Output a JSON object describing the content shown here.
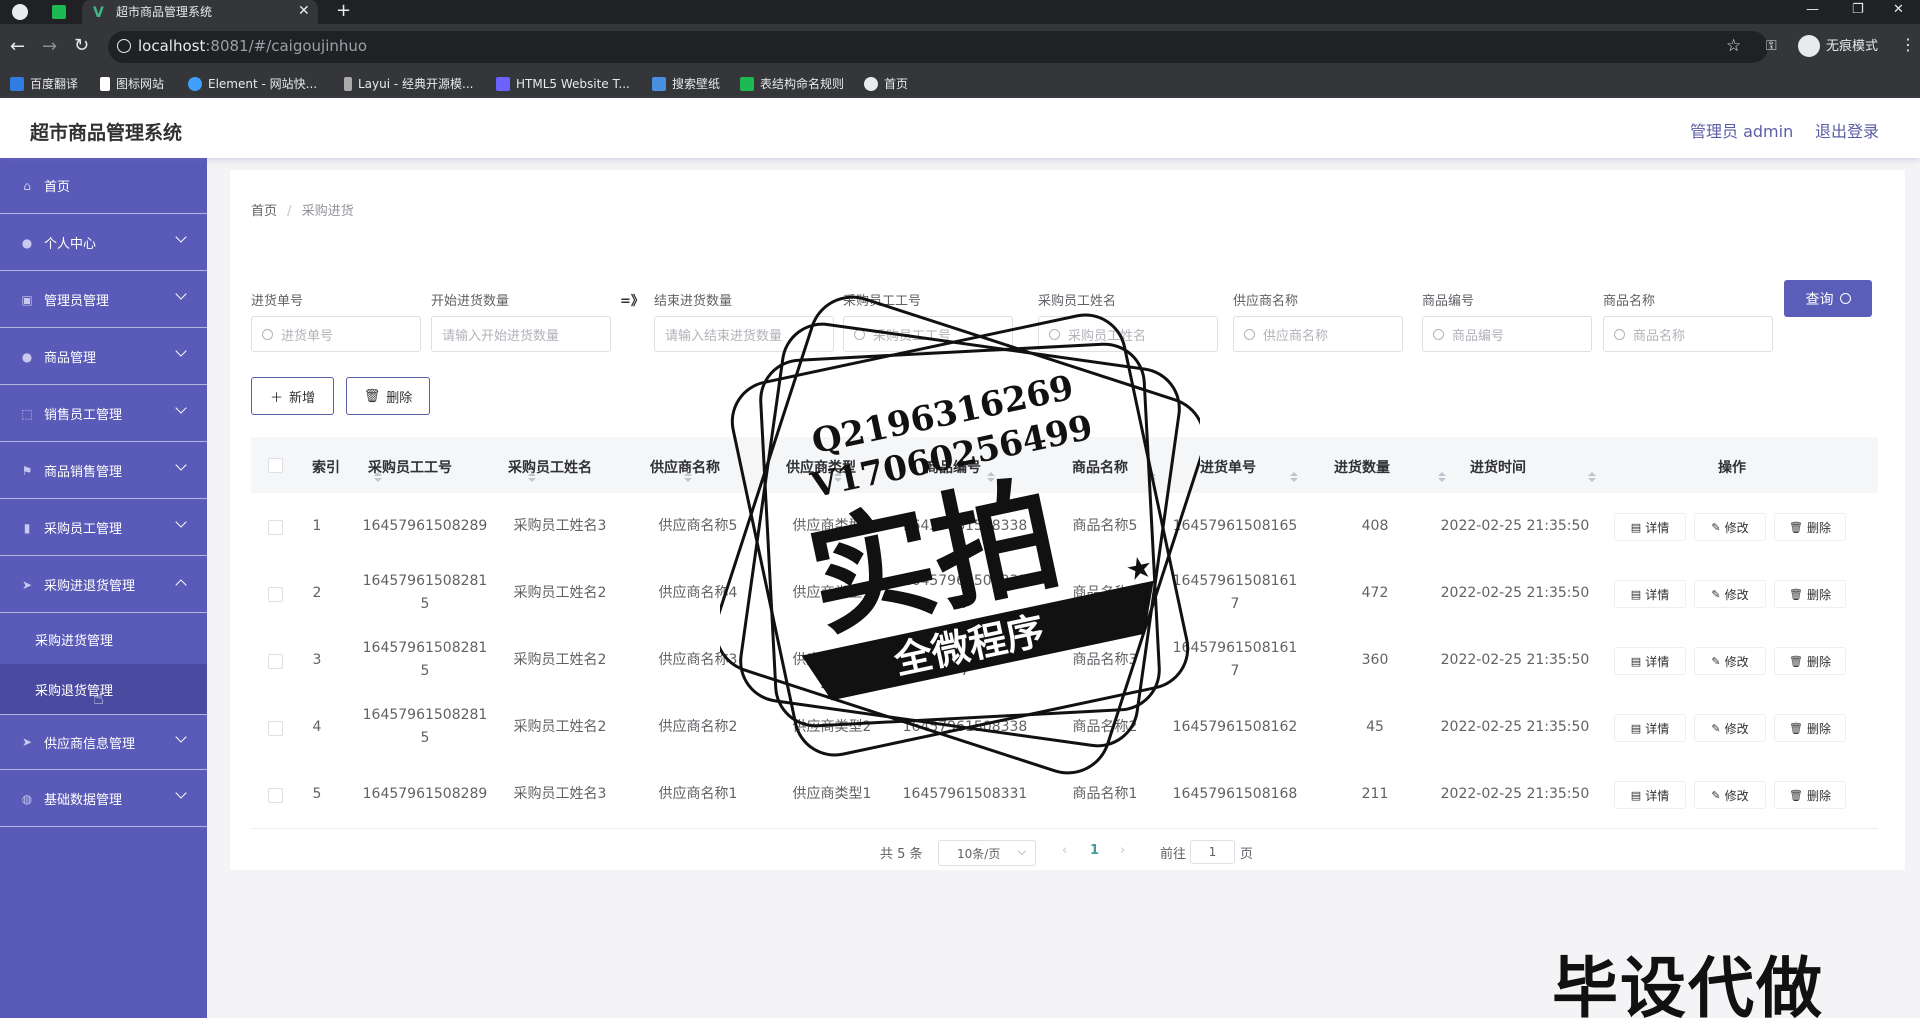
{
  "browser": {
    "tab_title": "超市商品管理系统",
    "url_host": "localhost",
    "url_rest": ":8081/#/caigoujinhuo",
    "profile_label": "无痕模式",
    "bookmarks": [
      "百度翻译",
      "图标网站",
      "Element - 网站快...",
      "Layui - 经典开源模...",
      "HTML5 Website T...",
      "搜索壁纸",
      "表结构命名规则",
      "首页"
    ]
  },
  "header": {
    "title": "超市商品管理系统",
    "user_label": "管理员 admin",
    "logout_label": "退出登录"
  },
  "sidebar": {
    "items": [
      {
        "label": "首页",
        "icon": "home-icon"
      },
      {
        "label": "个人中心",
        "icon": "user-icon"
      },
      {
        "label": "管理员管理",
        "icon": "briefcase-icon"
      },
      {
        "label": "商品管理",
        "icon": "user-icon"
      },
      {
        "label": "销售员工管理",
        "icon": "crop-icon"
      },
      {
        "label": "商品销售管理",
        "icon": "flag-icon"
      },
      {
        "label": "采购员工管理",
        "icon": "chart-icon"
      },
      {
        "label": "采购进退货管理",
        "icon": "send-icon"
      }
    ],
    "sub_items": [
      "采购进货管理",
      "采购退货管理"
    ],
    "items_after": [
      {
        "label": "供应商信息管理",
        "icon": "send-icon"
      },
      {
        "label": "基础数据管理",
        "icon": "globe-icon"
      }
    ]
  },
  "breadcrumb": {
    "home": "首页",
    "sep": "/",
    "current": "采购进货"
  },
  "filters": {
    "labels": [
      "进货单号",
      "开始进货数量",
      "结束进货数量",
      "采购员工工号",
      "采购员工姓名",
      "供应商名称",
      "商品编号",
      "商品名称"
    ],
    "range_sep": "=》",
    "placeholders": [
      "进货单号",
      "请输入开始进货数量",
      "请输入结束进货数量",
      "采购员工工号",
      "采购员工姓名",
      "供应商名称",
      "商品编号",
      "商品名称"
    ],
    "query_label": "查询"
  },
  "actions": {
    "add": "新增",
    "delete": "删除"
  },
  "table": {
    "columns": [
      "索引",
      "采购员工工号",
      "采购员工姓名",
      "供应商名称",
      "供应商类型",
      "商品编号",
      "商品名称",
      "进货单号",
      "进货数量",
      "进货时间",
      "操作"
    ],
    "rows": [
      [
        "1",
        "16457961508289",
        "采购员工姓名3",
        "供应商名称5",
        "供应商类型3",
        "16457961508338",
        "商品名称5",
        "16457961508165",
        "408",
        "2022-02-25 21:35:50"
      ],
      [
        "2",
        "164579615082815",
        "采购员工姓名2",
        "供应商名称4",
        "供应商类型1",
        "164579615083317",
        "商品名称4",
        "164579615081617",
        "472",
        "2022-02-25 21:35:50"
      ],
      [
        "3",
        "164579615082815",
        "采购员工姓名2",
        "供应商名称3",
        "供应商类型1",
        "164579615083317",
        "商品名称3",
        "164579615081617",
        "360",
        "2022-02-25 21:35:50"
      ],
      [
        "4",
        "164579615082815",
        "采购员工姓名2",
        "供应商名称2",
        "供应商类型2",
        "16457961508338",
        "商品名称2",
        "16457961508162",
        "45",
        "2022-02-25 21:35:50"
      ],
      [
        "5",
        "16457961508289",
        "采购员工姓名3",
        "供应商名称1",
        "供应商类型1",
        "16457961508331",
        "商品名称1",
        "16457961508168",
        "211",
        "2022-02-25 21:35:50"
      ]
    ],
    "row_actions": [
      "详情",
      "修改",
      "删除"
    ]
  },
  "pagination": {
    "total": "共 5 条",
    "page_size": "10条/页",
    "current_page": "1",
    "goto_prefix": "前往",
    "goto_value": "1",
    "goto_suffix": "页"
  },
  "stamp": {
    "line1": "Q2196316269",
    "line2": "V17060256499",
    "big": "实拍",
    "ribbon": "全微程序"
  },
  "watermark": "毕设代做",
  "colors": {
    "sidebar": "#5a5ab8",
    "accent": "#5b5eb8",
    "header_text": "#5b5ea6"
  }
}
